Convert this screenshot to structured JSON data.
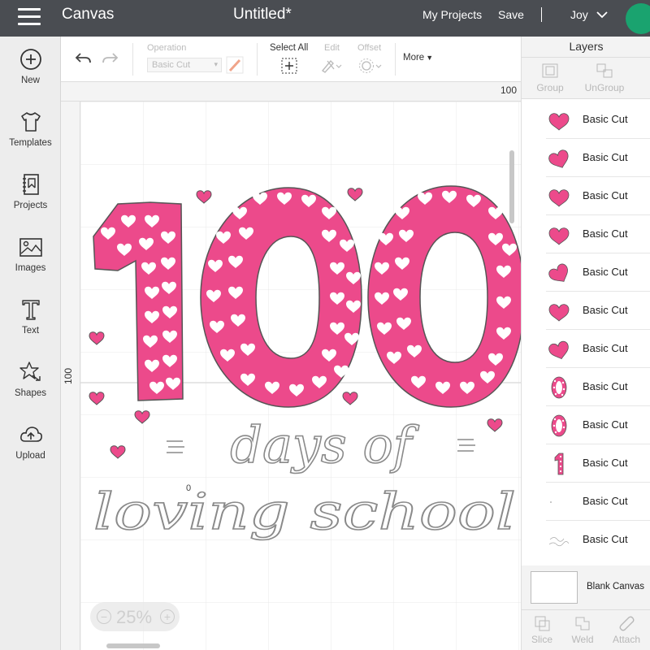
{
  "topbar": {
    "app_title": "Canvas",
    "doc_title": "Untitled*",
    "my_projects": "My Projects",
    "save": "Save",
    "separator": "|",
    "user": "Joy"
  },
  "sidebar": {
    "items": [
      {
        "label": "New",
        "icon": "plus-circle-icon"
      },
      {
        "label": "Templates",
        "icon": "tshirt-icon"
      },
      {
        "label": "Projects",
        "icon": "notebook-icon"
      },
      {
        "label": "Images",
        "icon": "image-icon"
      },
      {
        "label": "Text",
        "icon": "text-icon"
      },
      {
        "label": "Shapes",
        "icon": "shapes-icon"
      },
      {
        "label": "Upload",
        "icon": "cloud-upload-icon"
      }
    ]
  },
  "toolbar": {
    "operation_label": "Operation",
    "operation_value": "Basic Cut",
    "select_all": "Select All",
    "edit": "Edit",
    "offset": "Offset",
    "more": "More"
  },
  "canvas": {
    "ruler_top_value": "100",
    "ruler_left_value": "100",
    "zoom": "25%",
    "zoom_out": "−",
    "zoom_in": "+",
    "stray_mark": "0",
    "design": {
      "number": "100",
      "line1": "days of",
      "line2": "loving school",
      "fill_color": "#ec4a8b",
      "outline_color": "#8a8a8a"
    }
  },
  "layers": {
    "title": "Layers",
    "group": "Group",
    "ungroup": "UnGroup",
    "items": [
      {
        "label": "Basic Cut",
        "thumb": "heart"
      },
      {
        "label": "Basic Cut",
        "thumb": "heart"
      },
      {
        "label": "Basic Cut",
        "thumb": "heart"
      },
      {
        "label": "Basic Cut",
        "thumb": "heart"
      },
      {
        "label": "Basic Cut",
        "thumb": "heart"
      },
      {
        "label": "Basic Cut",
        "thumb": "heart"
      },
      {
        "label": "Basic Cut",
        "thumb": "heart"
      },
      {
        "label": "Basic Cut",
        "thumb": "zero"
      },
      {
        "label": "Basic Cut",
        "thumb": "zero"
      },
      {
        "label": "Basic Cut",
        "thumb": "one"
      },
      {
        "label": "Basic Cut",
        "thumb": "dot"
      },
      {
        "label": "Basic Cut",
        "thumb": "script"
      }
    ],
    "blank_canvas": "Blank Canvas",
    "bottom_tools": [
      "Slice",
      "Weld",
      "Attach"
    ]
  }
}
